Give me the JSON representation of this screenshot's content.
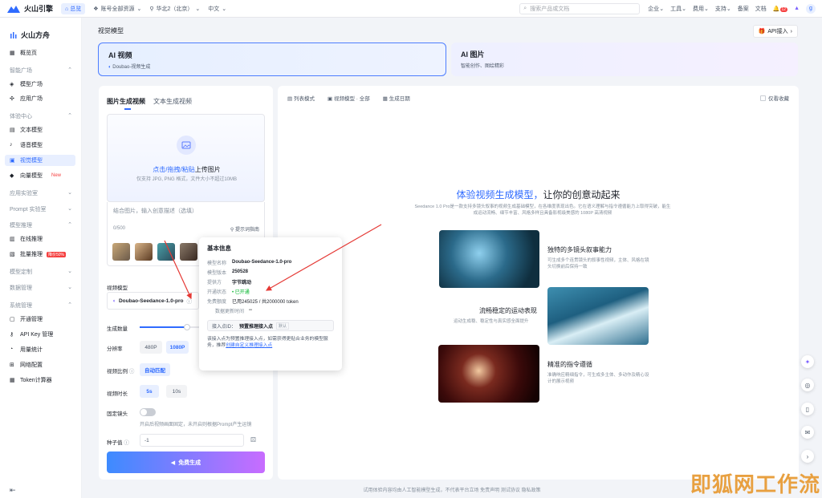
{
  "topbar": {
    "logo": "火山引擎",
    "home": "总览",
    "account_scope": "账号全部资源",
    "region": "华北2（北京）",
    "lang": "中文",
    "search_placeholder": "搜索产品或文档",
    "menu": [
      "企业",
      "工具",
      "费用",
      "支持",
      "备案",
      "文档"
    ],
    "notif_count": "12",
    "avatar": "g"
  },
  "sidebar": {
    "brand": "火山方舟",
    "overview": "概览页",
    "groups": [
      {
        "title": "智能广场",
        "items": [
          "模型广场",
          "应用广场"
        ]
      },
      {
        "title": "体验中心",
        "items": [
          "文本模型",
          "语音模型",
          "视觉模型",
          "向量模型"
        ]
      },
      {
        "title": "应用实验室"
      },
      {
        "title": "Prompt 实验室"
      },
      {
        "title": "模型推理",
        "items": [
          "在线推理",
          "批量推理"
        ]
      },
      {
        "title": "模型定制"
      },
      {
        "title": "数据管理"
      },
      {
        "title": "系统管理",
        "items": [
          "开通管理",
          "API Key 管理",
          "用量统计",
          "网络配置",
          "Token计算器"
        ]
      }
    ],
    "new_tag": "New",
    "discount_tag": "降价50%"
  },
  "main": {
    "title": "视觉模型",
    "api_btn": "API接入",
    "cards": [
      {
        "title": "AI 视频",
        "sub": "Doubao-视频生成"
      },
      {
        "title": "AI 图片",
        "sub": "智能创作、图绘精彩"
      }
    ]
  },
  "left": {
    "tabs": [
      "图片生成视频",
      "文本生成视频"
    ],
    "upload_action": "点击/拖拽/粘贴",
    "upload_suffix": "上传图片",
    "upload_hint": "仅支持 JPG, PNG 格式，文件大小不超过10MB",
    "prompt_placeholder": "结合图片，输入创意描述（选填）",
    "prompt_count": "0/500",
    "prompt_guide": "提示词指南",
    "label_model": "视频模型",
    "model": "Doubao-Seedance-1.0-pro",
    "label_count": "生成数量",
    "label_res": "分辨率",
    "res_opts": [
      "480P",
      "1080P"
    ],
    "label_ratio": "视频比例",
    "ratio_val": "自动匹配",
    "label_dur": "视频时长",
    "dur_opts": [
      "5s",
      "10s"
    ],
    "label_lens": "固定镜头",
    "lens_hint": "开启后视频画面固定，未开启则根据Prompt产生运镜",
    "label_seed": "种子值",
    "seed_val": "-1",
    "gen_btn": "免费生成"
  },
  "popup": {
    "title": "基本信息",
    "rows": [
      {
        "k": "模型名称",
        "v": "Doubao-Seedance-1.0-pro"
      },
      {
        "k": "模型版本",
        "v": "250528"
      },
      {
        "k": "提供方",
        "v": "字节跳动"
      },
      {
        "k": "开通状态",
        "v": "• 已开通"
      },
      {
        "k": "免费额度",
        "v": "已用245025 / 共2000000 token"
      },
      {
        "k": "数据更新时间",
        "v": "--"
      }
    ],
    "access_label": "接入点ID：",
    "access_val": "预置推理接入点",
    "access_tag": "默认",
    "note": "该接入点为预置推理接入点，如需获得更贴合业务的模型服务，推荐",
    "note_link": "创建自定义推理接入点"
  },
  "right": {
    "filters": [
      "列表模式",
      "视频模型 · 全部",
      "生成日期"
    ],
    "fav": "仅看收藏",
    "hero_blue": "体验视频生成模型，",
    "hero_black": "让你的创意动起来",
    "hero_sub": "Seedance 1.0 Pro是一款支持多镜头叙事的视频生成基础模型，在各维度表现出色。它在语义理解与指令遵循能力上取得突破，能生成运动流畅、细节丰富、风格多样且具备影视级美感的 1080P 高清视频",
    "features": [
      {
        "t": "独特的多镜头叙事能力",
        "s": "可生成多个连贯镜头的叙事性视频，主体、风格在镜头切换前后保持一致"
      },
      {
        "t": "流畅稳定的运动表现",
        "s": "运动生成稳、稳定性与真实感全面提升"
      },
      {
        "t": "精准的指令遵循",
        "s": "准确响应精细指令，可生成多主体、多动作及精心设计的展示视频"
      }
    ]
  },
  "footer": "试用体验内容均由人工智能模型生成，不代表平台立场    免责声明    测试协议    隐私政策",
  "watermark": "即狐网工作流"
}
